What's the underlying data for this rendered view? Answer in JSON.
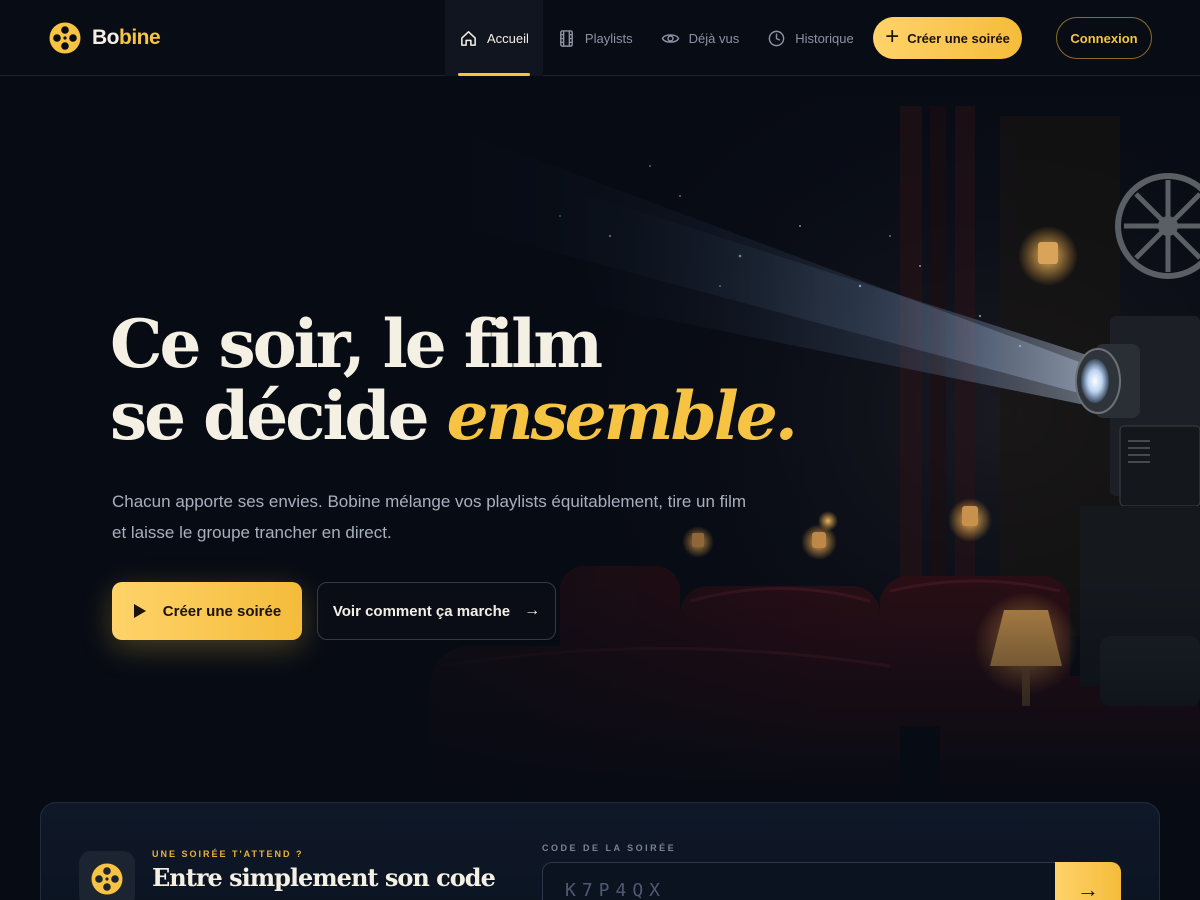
{
  "brand": {
    "name_part1": "Bo",
    "name_part2": "bine",
    "icon": "film-reel-icon"
  },
  "nav": {
    "items": [
      {
        "label": "Accueil",
        "icon": "home-icon",
        "active": true
      },
      {
        "label": "Playlists",
        "icon": "film-strip-icon",
        "active": false
      },
      {
        "label": "Déjà vus",
        "icon": "eye-icon",
        "active": false
      },
      {
        "label": "Historique",
        "icon": "clock-icon",
        "active": false
      }
    ]
  },
  "header": {
    "create_label": "Créer une soirée",
    "login_label": "Connexion"
  },
  "hero": {
    "title_line1": "Ce soir, le film",
    "title_line2_plain": "se décide ",
    "title_line2_accent": "ensemble.",
    "text": "Chacun apporte ses envies. Bobine mélange vos playlists équitablement, tire un film et laisse le groupe trancher en direct.",
    "primary_label": "Créer une soirée",
    "secondary_label": "Voir comment ça marche"
  },
  "join": {
    "eyebrow": "UNE SOIRÉE T'ATTEND ?",
    "title": "Entre simplement son code",
    "code_label": "CODE DE LA SOIRÉE",
    "code_placeholder": "K7P4QX"
  },
  "colors": {
    "accent": "#f6c343",
    "background": "#070b14",
    "text": "#f5f0e4",
    "muted": "#a9afbd"
  }
}
